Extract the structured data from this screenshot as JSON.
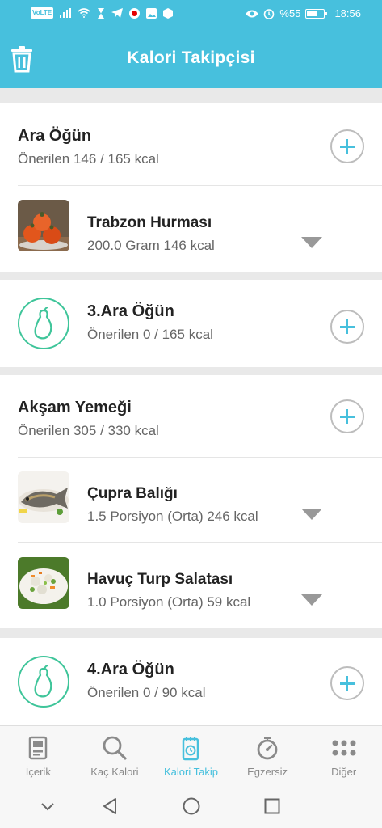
{
  "status_bar": {
    "volte": "VoLTE",
    "signal": "⫶",
    "battery_percent": "%55",
    "time": "18:56"
  },
  "header": {
    "title": "Kalori Takipçisi",
    "trash_icon": "trash-icon"
  },
  "meals": [
    {
      "title": "Ara Öğün",
      "suggestion": "Önerilen 146 / 165 kcal",
      "foods": [
        {
          "name": "Trabzon Hurması",
          "detail": "200.0 Gram 146 kcal",
          "image": "persimmon"
        }
      ]
    },
    {
      "title": "3.Ara Öğün",
      "suggestion": "Önerilen 0 / 165 kcal",
      "icon": "pear-icon"
    },
    {
      "title": "Akşam Yemeği",
      "suggestion": "Önerilen 305 / 330 kcal",
      "foods": [
        {
          "name": "Çupra Balığı",
          "detail": "1.5 Porsiyon (Orta) 246 kcal",
          "image": "grilled-fish"
        },
        {
          "name": "Havuç Turp Salatası",
          "detail": "1.0 Porsiyon (Orta) 59 kcal",
          "image": "salad"
        }
      ]
    },
    {
      "title": "4.Ara Öğün",
      "suggestion": "Önerilen 0 / 90 kcal",
      "icon": "pear-icon"
    }
  ],
  "bottom_nav": [
    {
      "label": "İçerik",
      "icon": "document-icon",
      "active": false
    },
    {
      "label": "Kaç Kalori",
      "icon": "search-icon",
      "active": false
    },
    {
      "label": "Kalori Takip",
      "icon": "notepad-icon",
      "active": true
    },
    {
      "label": "Egzersiz",
      "icon": "stopwatch-icon",
      "active": false
    },
    {
      "label": "Diğer",
      "icon": "more-dots-icon",
      "active": false
    }
  ],
  "colors": {
    "accent": "#47c0dd",
    "pear_green": "#3fc59a",
    "background": "#e9e9e9"
  }
}
